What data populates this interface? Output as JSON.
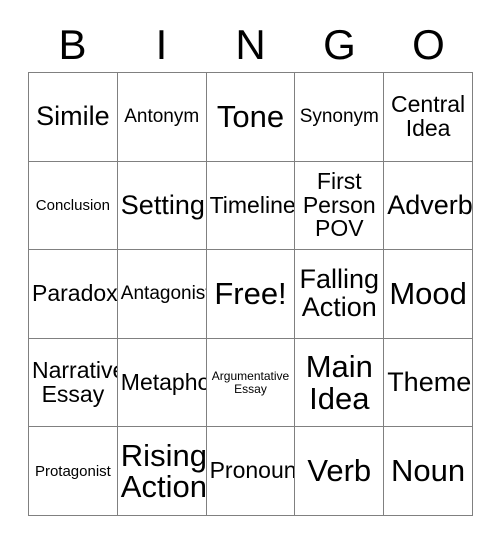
{
  "card": {
    "type": "bingo-card",
    "background_color": "#ffffff",
    "text_color": "#000000",
    "grid_line_color": "#808080",
    "columns": 5,
    "rows": 5
  },
  "header": {
    "letters": [
      "B",
      "I",
      "N",
      "G",
      "O"
    ]
  },
  "grid": {
    "rows": [
      {
        "cells": [
          {
            "label": "Simile",
            "size": "xl"
          },
          {
            "label": "Antonym",
            "size": "md"
          },
          {
            "label": "Tone",
            "size": "xxl"
          },
          {
            "label": "Synonym",
            "size": "md"
          },
          {
            "label": "Central\nIdea",
            "size": "lg"
          }
        ]
      },
      {
        "cells": [
          {
            "label": "Conclusion",
            "size": "sm"
          },
          {
            "label": "Setting",
            "size": "xl"
          },
          {
            "label": "Timeline",
            "size": "lg"
          },
          {
            "label": "First\nPerson\nPOV",
            "size": "lg"
          },
          {
            "label": "Adverb",
            "size": "xl"
          }
        ]
      },
      {
        "cells": [
          {
            "label": "Paradox",
            "size": "lg"
          },
          {
            "label": "Antagonist",
            "size": "md"
          },
          {
            "label": "Free!",
            "size": "xxl"
          },
          {
            "label": "Falling\nAction",
            "size": "xl"
          },
          {
            "label": "Mood",
            "size": "xxl"
          }
        ]
      },
      {
        "cells": [
          {
            "label": "Narrative\nEssay",
            "size": "lg"
          },
          {
            "label": "Metaphor",
            "size": "lg"
          },
          {
            "label": "Argumentative\nEssay",
            "size": "xs"
          },
          {
            "label": "Main\nIdea",
            "size": "xxl"
          },
          {
            "label": "Theme",
            "size": "xl"
          }
        ]
      },
      {
        "cells": [
          {
            "label": "Protagonist",
            "size": "sm"
          },
          {
            "label": "Rising\nAction",
            "size": "xxl"
          },
          {
            "label": "Pronoun",
            "size": "lg"
          },
          {
            "label": "Verb",
            "size": "xxl"
          },
          {
            "label": "Noun",
            "size": "xxl"
          }
        ]
      }
    ]
  }
}
